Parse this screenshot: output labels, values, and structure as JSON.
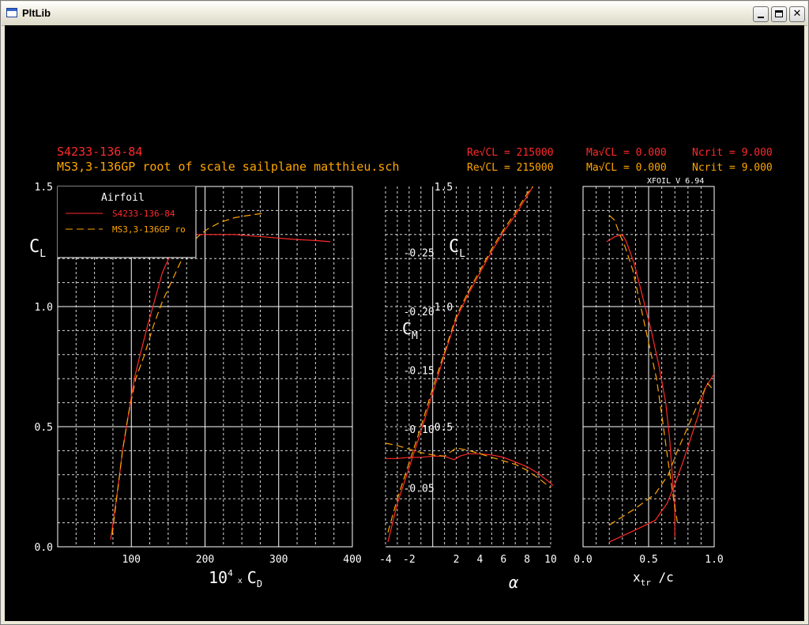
{
  "window": {
    "title": "PltLib",
    "buttons": {
      "minimize": "minimize-icon",
      "maximize": "maximize-icon",
      "close": "close-icon"
    }
  },
  "colors": {
    "background": "#000000",
    "grid": "#ffffff",
    "series1": "#ff2a2a",
    "series2": "#ffa500"
  },
  "header": {
    "line1": {
      "name": "S4233-136-84",
      "re": "Re√CL = 215000",
      "ma": "Ma√CL = 0.000",
      "ncrit": "Ncrit = 9.000"
    },
    "line2": {
      "name": "MS3,3-136GP root of scale sailplane matthieu.sch",
      "re": "Re√CL = 215000",
      "ma": "Ma√CL = 0.000",
      "ncrit": "Ncrit = 9.000"
    },
    "version": "XFOIL V 6.94"
  },
  "legend": {
    "title": "Airfoil",
    "entries": [
      "S4233-136-84",
      "MS3,3-136GP ro"
    ]
  },
  "chart_data": [
    {
      "type": "line",
      "panel": "drag-polar",
      "xlabel": "10⁴ x C_D",
      "ylabel": "C_L",
      "xlim": [
        0,
        400
      ],
      "ylim": [
        0,
        1.5
      ],
      "xticks": [
        "100",
        "200",
        "300",
        "400"
      ],
      "yticks": [
        "0.0",
        "0.5",
        "1.0",
        "1.5"
      ],
      "grid": true,
      "legend_position": "top-left",
      "series": [
        {
          "name": "S4233-136-84",
          "color": "#ff2a2a",
          "dash": "solid",
          "points": [
            [
              72,
              0.03
            ],
            [
              76,
              0.12
            ],
            [
              82,
              0.25
            ],
            [
              88,
              0.4
            ],
            [
              96,
              0.55
            ],
            [
              104,
              0.7
            ],
            [
              112,
              0.8
            ],
            [
              122,
              0.92
            ],
            [
              132,
              1.03
            ],
            [
              142,
              1.14
            ],
            [
              152,
              1.21
            ],
            [
              162,
              1.26
            ],
            [
              172,
              1.28
            ],
            [
              182,
              1.3
            ],
            [
              200,
              1.3
            ],
            [
              240,
              1.3
            ],
            [
              280,
              1.29
            ],
            [
              320,
              1.28
            ],
            [
              350,
              1.275
            ],
            [
              370,
              1.27
            ]
          ]
        },
        {
          "name": "MS3,3-136GP ro",
          "color": "#ffa500",
          "dash": "dashed",
          "points": [
            [
              74,
              0.05
            ],
            [
              80,
              0.2
            ],
            [
              88,
              0.4
            ],
            [
              96,
              0.55
            ],
            [
              106,
              0.7
            ],
            [
              118,
              0.8
            ],
            [
              130,
              0.92
            ],
            [
              142,
              1.02
            ],
            [
              154,
              1.1
            ],
            [
              166,
              1.18
            ],
            [
              178,
              1.25
            ],
            [
              190,
              1.29
            ],
            [
              202,
              1.32
            ],
            [
              220,
              1.35
            ],
            [
              240,
              1.37
            ],
            [
              260,
              1.38
            ],
            [
              282,
              1.39
            ]
          ]
        }
      ]
    },
    {
      "type": "line",
      "panel": "lift-and-moment-vs-alpha",
      "xlabel": "α",
      "ylabel": "C_L",
      "y2label": "C_M",
      "xlim": [
        -4,
        10
      ],
      "ylim": [
        0,
        1.5
      ],
      "cm_lim": [
        -0.3,
        0.0
      ],
      "xticks": [
        "-4",
        "-2",
        "2",
        "4",
        "6",
        "8",
        "10"
      ],
      "yticks": [
        "0.5",
        "1.0",
        "1.5"
      ],
      "cm_ticks": [
        "-0.05",
        "-0.10",
        "-0.15",
        "-0.20",
        "-0.25"
      ],
      "grid": true,
      "series": [
        {
          "name": "S4233-136-84",
          "quantity": "CL",
          "color": "#ff2a2a",
          "dash": "solid",
          "points": [
            [
              -3.8,
              0.02
            ],
            [
              -3,
              0.18
            ],
            [
              -2,
              0.33
            ],
            [
              -1,
              0.48
            ],
            [
              0,
              0.64
            ],
            [
              1,
              0.8
            ],
            [
              2,
              0.95
            ],
            [
              3,
              1.05
            ],
            [
              4,
              1.14
            ],
            [
              5,
              1.23
            ],
            [
              6,
              1.31
            ],
            [
              7,
              1.38
            ],
            [
              8,
              1.46
            ],
            [
              8.5,
              1.5
            ]
          ]
        },
        {
          "name": "MS3,3-136GP ro",
          "quantity": "CL",
          "color": "#ffa500",
          "dash": "dashed",
          "points": [
            [
              -3.8,
              0.06
            ],
            [
              -3,
              0.2
            ],
            [
              -2,
              0.35
            ],
            [
              -1,
              0.5
            ],
            [
              0,
              0.66
            ],
            [
              1,
              0.81
            ],
            [
              2,
              0.96
            ],
            [
              3,
              1.06
            ],
            [
              4,
              1.15
            ],
            [
              5,
              1.24
            ],
            [
              6,
              1.32
            ],
            [
              7,
              1.39
            ],
            [
              8,
              1.47
            ],
            [
              8.5,
              1.5
            ]
          ]
        },
        {
          "name": "S4233-136-84",
          "quantity": "CM",
          "color": "#ff2a2a",
          "dash": "solid",
          "points": [
            [
              -4,
              -0.075
            ],
            [
              -3,
              -0.075
            ],
            [
              -2,
              -0.076
            ],
            [
              -1,
              -0.076
            ],
            [
              0,
              -0.077
            ],
            [
              1,
              -0.077
            ],
            [
              1.8,
              -0.074
            ],
            [
              2.3,
              -0.077
            ],
            [
              3,
              -0.079
            ],
            [
              4,
              -0.079
            ],
            [
              5,
              -0.078
            ],
            [
              6,
              -0.076
            ],
            [
              7,
              -0.072
            ],
            [
              8,
              -0.068
            ],
            [
              9,
              -0.062
            ],
            [
              10,
              -0.054
            ],
            [
              10.2,
              -0.052
            ]
          ]
        },
        {
          "name": "MS3,3-136GP ro",
          "quantity": "CM",
          "color": "#ffa500",
          "dash": "dashed",
          "points": [
            [
              -4,
              -0.088
            ],
            [
              -3,
              -0.086
            ],
            [
              -2,
              -0.083
            ],
            [
              -1,
              -0.08
            ],
            [
              0,
              -0.078
            ],
            [
              1,
              -0.077
            ],
            [
              2,
              -0.084
            ],
            [
              3,
              -0.082
            ],
            [
              4,
              -0.079
            ],
            [
              5,
              -0.076
            ],
            [
              6,
              -0.073
            ],
            [
              7,
              -0.07
            ],
            [
              8,
              -0.065
            ],
            [
              9,
              -0.058
            ],
            [
              10,
              -0.05
            ]
          ]
        }
      ]
    },
    {
      "type": "line",
      "panel": "transition-location",
      "xlabel": "x_tr / c",
      "xlim": [
        0,
        1.0
      ],
      "ylim": [
        0,
        1.5
      ],
      "xticks": [
        "0.0",
        "0.5",
        "1.0"
      ],
      "grid": true,
      "series": [
        {
          "name": "S4233-136-84",
          "side": "top",
          "color": "#ff2a2a",
          "dash": "solid",
          "points": [
            [
              0.7,
              0.04
            ],
            [
              0.7,
              0.15
            ],
            [
              0.68,
              0.3
            ],
            [
              0.66,
              0.45
            ],
            [
              0.63,
              0.6
            ],
            [
              0.58,
              0.75
            ],
            [
              0.52,
              0.9
            ],
            [
              0.45,
              1.05
            ],
            [
              0.39,
              1.18
            ],
            [
              0.33,
              1.27
            ],
            [
              0.3,
              1.3
            ],
            [
              0.24,
              1.29
            ],
            [
              0.18,
              1.27
            ]
          ]
        },
        {
          "name": "MS3,3-136GP ro",
          "side": "top",
          "color": "#ffa500",
          "dash": "dashed",
          "points": [
            [
              0.72,
              0.1
            ],
            [
              0.69,
              0.2
            ],
            [
              0.65,
              0.35
            ],
            [
              0.6,
              0.55
            ],
            [
              0.56,
              0.7
            ],
            [
              0.5,
              0.85
            ],
            [
              0.44,
              1.0
            ],
            [
              0.38,
              1.15
            ],
            [
              0.32,
              1.25
            ],
            [
              0.28,
              1.3
            ],
            [
              0.24,
              1.36
            ],
            [
              0.2,
              1.38
            ]
          ]
        },
        {
          "name": "S4233-136-84",
          "side": "bottom",
          "color": "#ff2a2a",
          "dash": "solid",
          "points": [
            [
              0.2,
              0.02
            ],
            [
              0.4,
              0.07
            ],
            [
              0.55,
              0.11
            ],
            [
              0.64,
              0.18
            ],
            [
              0.7,
              0.26
            ],
            [
              0.76,
              0.35
            ],
            [
              0.82,
              0.45
            ],
            [
              0.88,
              0.55
            ],
            [
              0.93,
              0.66
            ],
            [
              1.0,
              0.72
            ]
          ]
        },
        {
          "name": "MS3,3-136GP ro",
          "side": "bottom",
          "color": "#ffa500",
          "dash": "dashed",
          "points": [
            [
              0.2,
              0.09
            ],
            [
              0.4,
              0.16
            ],
            [
              0.55,
              0.22
            ],
            [
              0.65,
              0.3
            ],
            [
              0.72,
              0.4
            ],
            [
              0.8,
              0.5
            ],
            [
              0.88,
              0.6
            ],
            [
              0.95,
              0.68
            ],
            [
              1.0,
              0.65
            ]
          ]
        }
      ]
    }
  ]
}
